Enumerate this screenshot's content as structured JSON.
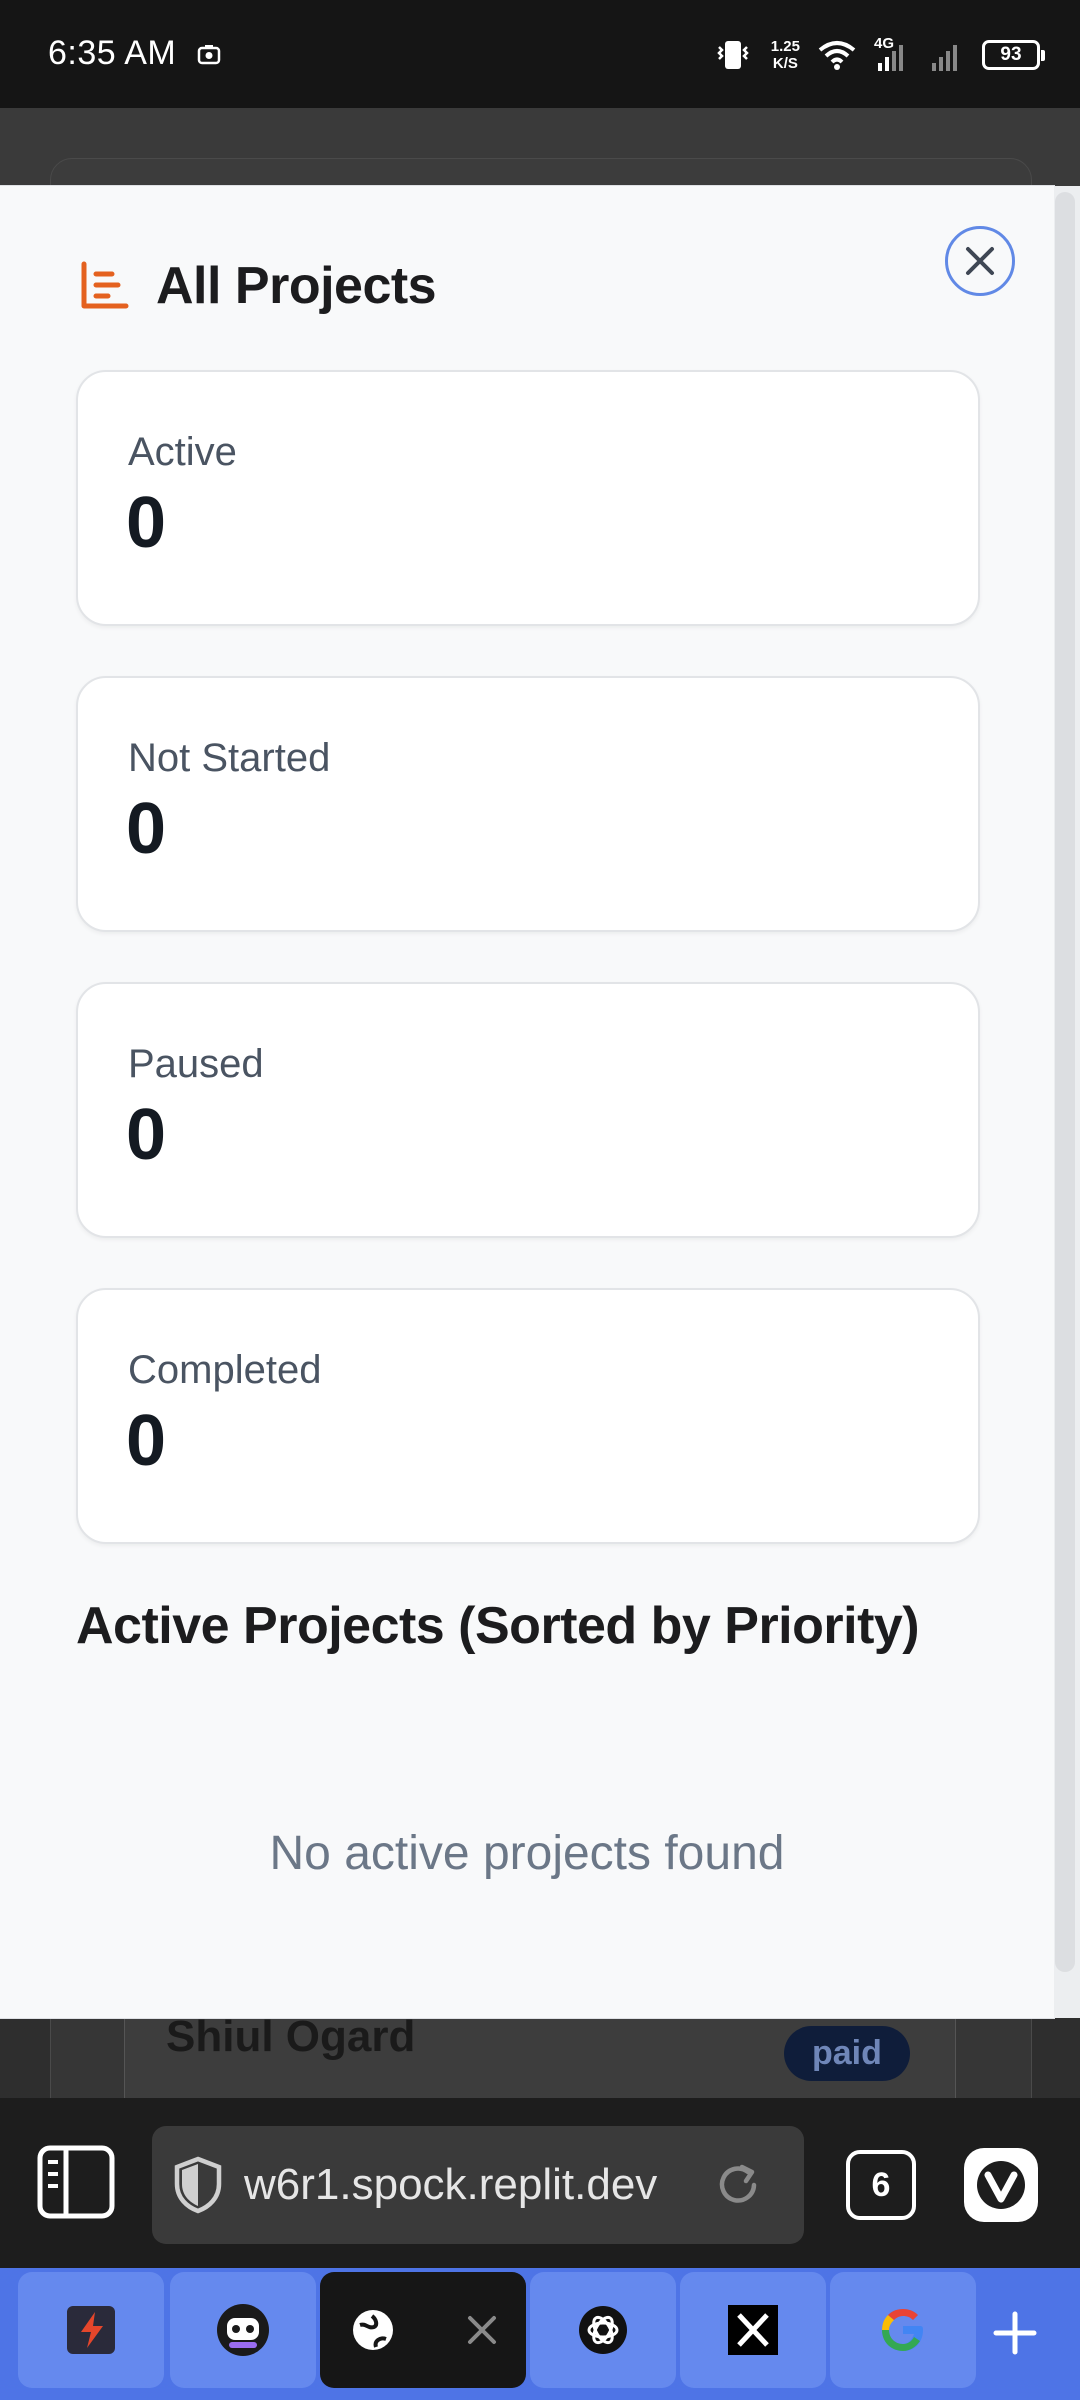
{
  "status_bar": {
    "time": "6:35 AM",
    "net_speed_value": "1.25",
    "net_speed_unit": "K/S",
    "network_type": "4G",
    "battery": "93",
    "icons": [
      "screenshot-icon",
      "vibrate-icon",
      "wifi-icon",
      "signal-icon",
      "signal-icon-2",
      "battery-icon"
    ]
  },
  "background_page": {
    "card_name": "Shiul Ogard",
    "badge": "paid"
  },
  "modal": {
    "title": "All Projects",
    "title_icon": "chart-list-icon",
    "close_icon": "close-icon",
    "accent_color": "#e4611f",
    "close_ring_color": "#6189e6",
    "stats": [
      {
        "label": "Active",
        "value": "0"
      },
      {
        "label": "Not Started",
        "value": "0"
      },
      {
        "label": "Paused",
        "value": "0"
      },
      {
        "label": "Completed",
        "value": "0"
      }
    ],
    "section_title": "Active Projects (Sorted by Priority)",
    "empty_message": "No active projects found"
  },
  "browser": {
    "url": "w6r1.spock.replit.dev",
    "tab_count": "6",
    "icons": [
      "panel-icon",
      "shield-icon",
      "reload-icon",
      "vivaldi-icon"
    ]
  },
  "tab_strip": {
    "tabs": [
      {
        "icon": "bolt-app-icon"
      },
      {
        "icon": "robot-app-icon"
      },
      {
        "icon": "globe-icon",
        "active": true
      },
      {
        "icon": "openai-icon"
      },
      {
        "icon": "x-logo-icon"
      },
      {
        "icon": "google-icon"
      }
    ],
    "add_icon": "plus-icon"
  }
}
